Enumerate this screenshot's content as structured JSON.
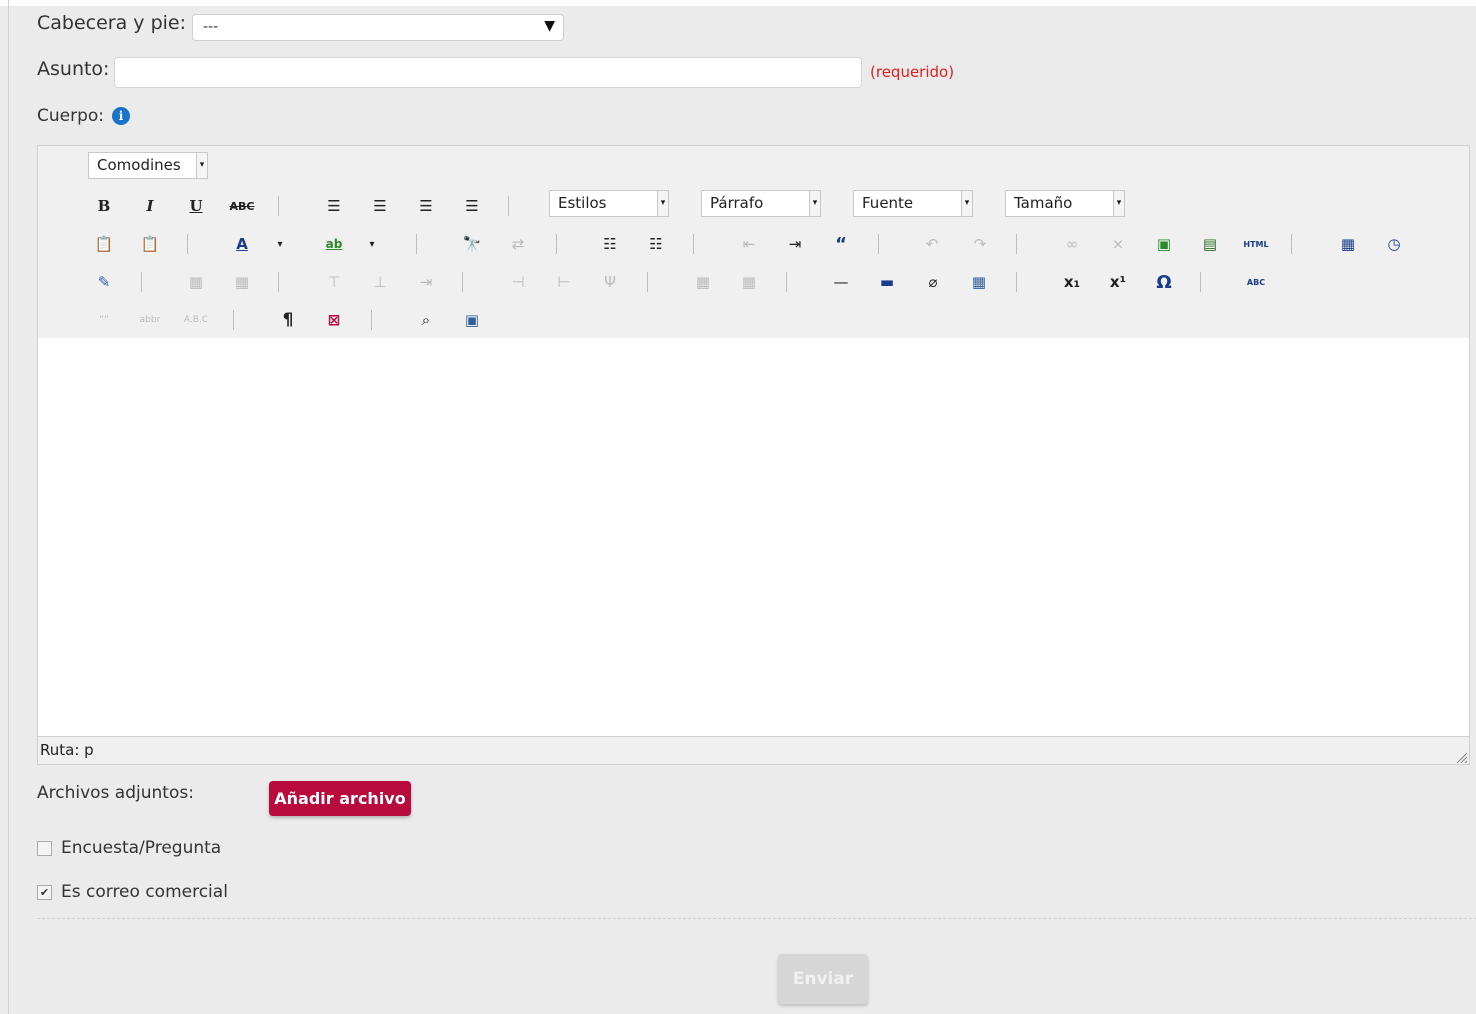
{
  "header_footer": {
    "label": "Cabecera y pie:",
    "value": "---"
  },
  "subject": {
    "label": "Asunto:",
    "value": "",
    "required_note": "(requerido)"
  },
  "body": {
    "label": "Cuerpo:"
  },
  "editor": {
    "wildcards_label": "Comodines",
    "styles_label": "Estilos",
    "paragraph_label": "Párrafo",
    "font_label": "Fuente",
    "size_label": "Tamaño",
    "path_text": "Ruta: p",
    "html_label": "HTML",
    "abc_label": "ABC"
  },
  "attachments": {
    "label": "Archivos adjuntos:",
    "add_button": "Añadir archivo"
  },
  "poll": {
    "label": "Encuesta/Pregunta",
    "checked": false
  },
  "commercial": {
    "label": "Es correo comercial",
    "checked": true
  },
  "send_button": "Enviar",
  "colors": {
    "accent": "#b80a3c",
    "required": "#e02020",
    "info": "#1a73c9"
  }
}
